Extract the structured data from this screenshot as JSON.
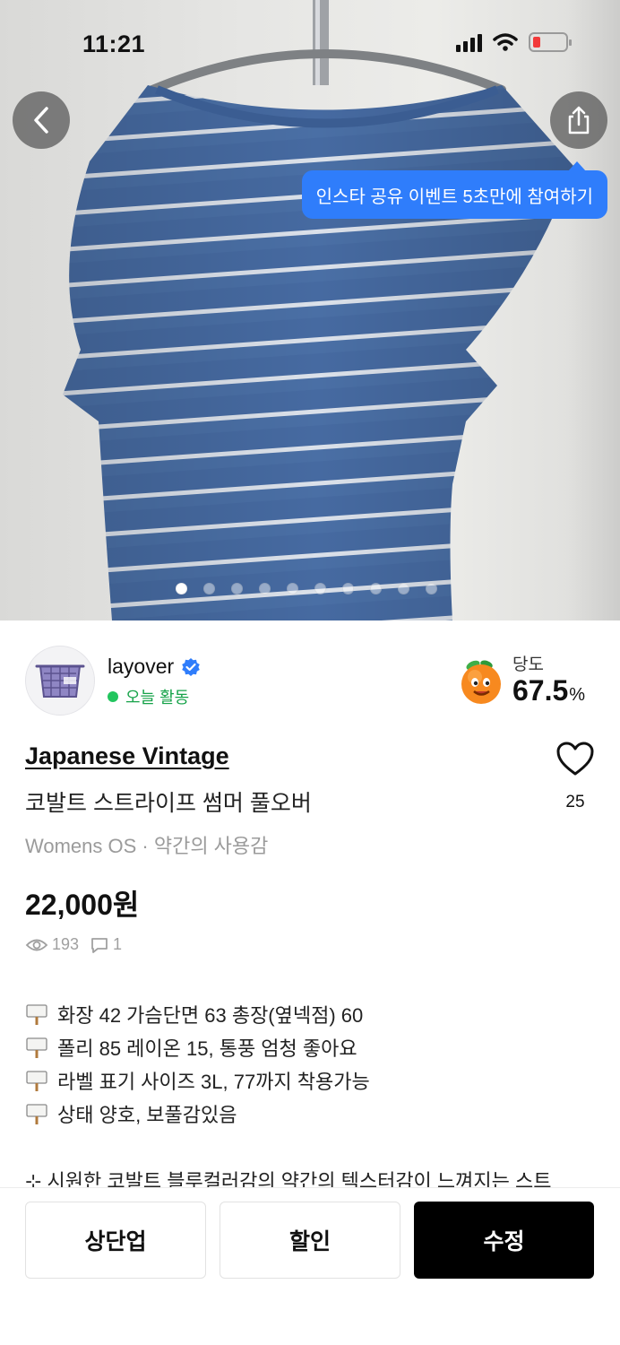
{
  "status_bar": {
    "time": "11:21"
  },
  "hero": {
    "share_tooltip": "인스타 공유 이벤트 5초만에 참여하기",
    "image_count": 10,
    "current_image": 1
  },
  "seller": {
    "name": "layover",
    "verified": true,
    "activity": "오늘 활동",
    "sweetness_label": "당도",
    "sweetness_value": "67.5",
    "sweetness_unit": "%"
  },
  "product": {
    "brand": "Japanese Vintage",
    "title": "코발트 스트라이프 썸머 풀오버",
    "meta": "Womens OS · 약간의 사용감",
    "price": "22,000원",
    "likes": "25",
    "views": "193",
    "comments": "1",
    "description_lines": [
      "화장 42 가슴단면 63 총장(옆넥점) 60",
      "폴리 85 레이온 15, 통풍 엄청 좋아요",
      "라벨 표기 사이즈 3L, 77까지 착용가능",
      "상태 양호, 보풀감있음"
    ],
    "description_more": "⊹ 시원한 코발트 블루컬러감의 약간의 텍스터감이 느껴지는 스트"
  },
  "actions": {
    "bump": "상단업",
    "discount": "할인",
    "edit": "수정"
  },
  "colors": {
    "accent_blue": "#2f7dfb",
    "active_green": "#22c55e",
    "verified_blue": "#2f7dfb",
    "primary_button": "#000000"
  }
}
